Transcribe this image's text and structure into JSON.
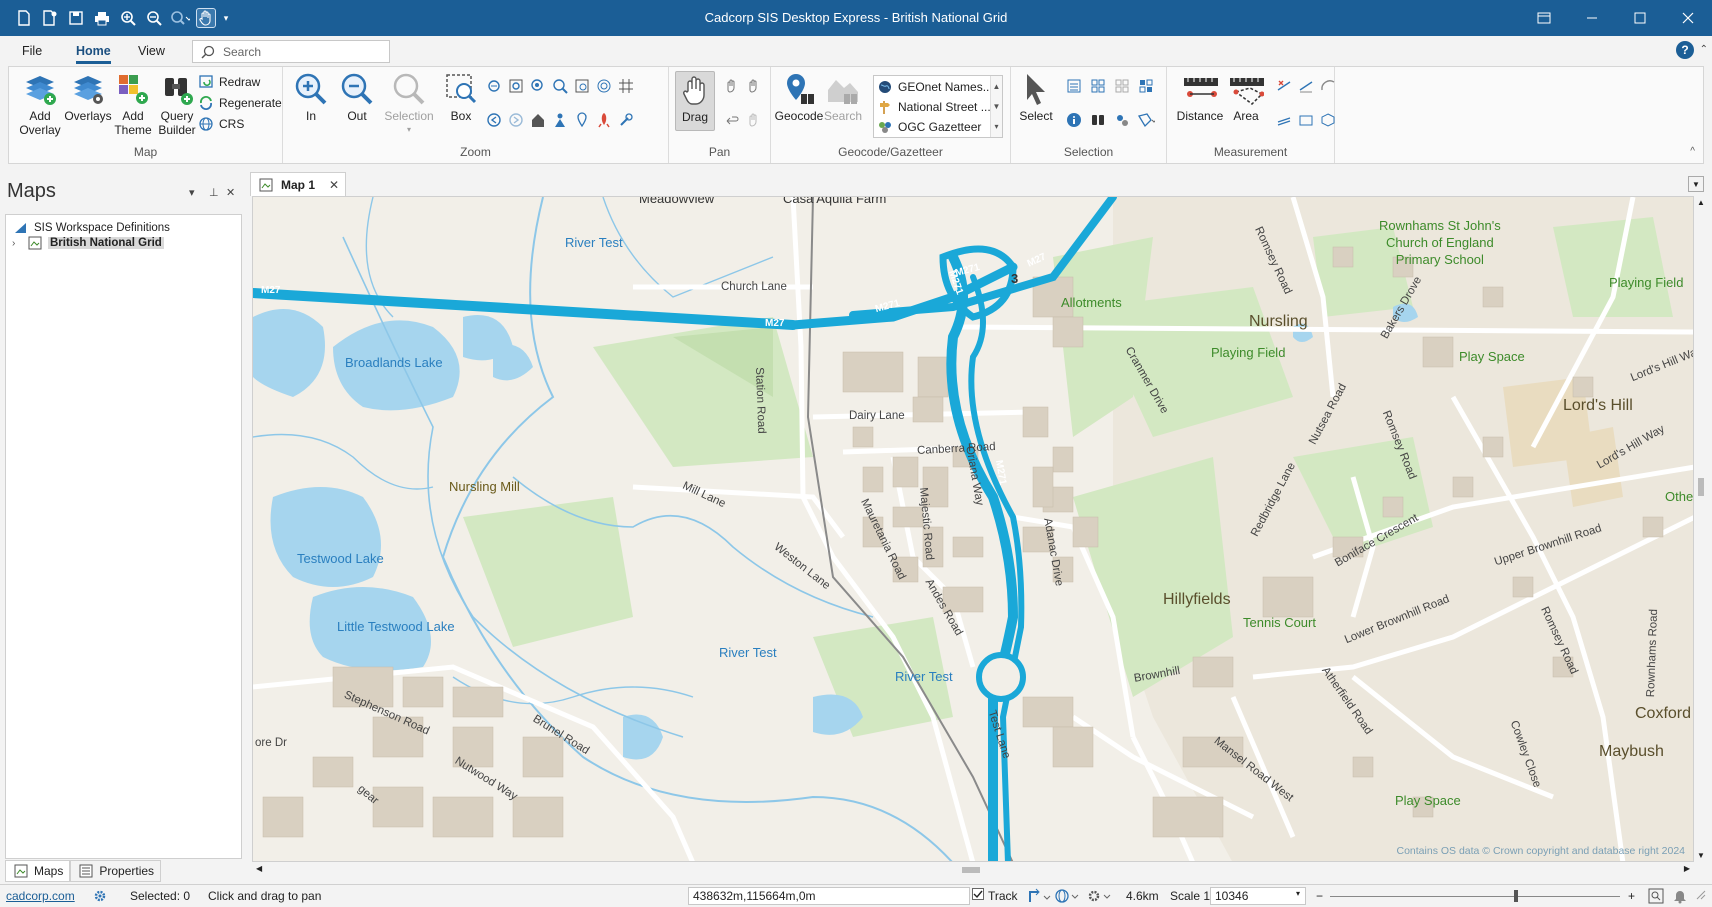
{
  "window": {
    "title": "Cadcorp SIS Desktop Express - British National Grid",
    "controls": [
      "restore-icon",
      "minimize-icon",
      "maximize-icon",
      "close-icon"
    ]
  },
  "ribbon_tabs": {
    "file": "File",
    "home": "Home",
    "view": "View",
    "search_placeholder": "Search"
  },
  "ribbon": {
    "map": {
      "label": "Map",
      "add_overlay": "Add\nOverlay",
      "overlays": "Overlays",
      "add_theme": "Add\nTheme",
      "query_builder": "Query\nBuilder",
      "redraw": "Redraw",
      "regenerate": "Regenerate",
      "crs": "CRS"
    },
    "zoom": {
      "label": "Zoom",
      "in": "In",
      "out": "Out",
      "selection": "Selection",
      "box": "Box"
    },
    "pan": {
      "label": "Pan",
      "drag": "Drag"
    },
    "geocode": {
      "label": "Geocode/Gazetteer",
      "geocode": "Geocode",
      "search": "Search",
      "gazetteers": [
        "GEOnet Names...",
        "National Street ...",
        "OGC Gazetteer"
      ]
    },
    "selection": {
      "label": "Selection",
      "select": "Select"
    },
    "measurement": {
      "label": "Measurement",
      "distance": "Distance",
      "area": "Area"
    }
  },
  "left_panel": {
    "title": "Maps",
    "tree_root": "SIS Workspace Definitions",
    "tree_child": "British National Grid",
    "tabs": [
      "Maps",
      "Properties"
    ]
  },
  "document_tab": {
    "label": "Map 1"
  },
  "map": {
    "labels": {
      "meadowview": "Meadowview",
      "casa_aquila": "Casa Aquila Farm",
      "river_test_1": "River Test",
      "church_lane": "Church Lane",
      "m27_left": "M27",
      "m27_mid": "M27",
      "m271_a": "M271",
      "m271_b": "M271",
      "m271_c": "M271",
      "m271_d": "M271",
      "m27_right": "M27",
      "junction_3": "3",
      "allotments": "Allotments",
      "rownhams": "Rownhams St John's\nChurch of England\nPrimary School",
      "playing_field_1": "Playing Field",
      "nursling": "Nursling",
      "playing_field_2": "Playing Field",
      "play_space_1": "Play Space",
      "broadlands_lake": "Broadlands Lake",
      "station_road": "Station Road",
      "dairy_lane": "Dairy Lane",
      "lords_hill": "Lord's Hill",
      "canberra_road": "Canberra Road",
      "nursling_mill": "Nursling Mill",
      "mill_lane": "Mill Lane",
      "testwood_lake": "Testwood Lake",
      "little_testwood_lake": "Little Testwood Lake",
      "weston_lane": "Weston Lane",
      "mauretania_road": "Mauretania Road",
      "majestic_road": "Majestic Road",
      "oriana_way": "Oriana Way",
      "adanac_drive": "Adanac Drive",
      "hillyfields": "Hillyfields",
      "tennis_court": "Tennis Court",
      "boniface_crescent": "Boniface Crescent",
      "upper_brownhill_road": "Upper Brownhill Road",
      "lower_brownhill_road": "Lower Brownhill Road",
      "river_test_2": "River Test",
      "river_test_3": "River Test",
      "andes_road": "Andes Road",
      "brownhill": "Brownhill",
      "stephenson_road": "Stephenson Road",
      "brunel_road": "Brunel Road",
      "nutwood_way": "Nutwood Way",
      "test_lane": "Test Lane",
      "mansel_road_west": "Mansel Road West",
      "athefield_road": "Atherfield Road",
      "romsey_road_1": "Romsey Road",
      "romsey_road_2": "Romsey Road",
      "romsey_road_3": "Romsey Road",
      "rownhams_road": "Rownhams Road",
      "redbridge_lane": "Redbridge Lane",
      "nutsea_road": "Nutsea Road",
      "cranmer_drive": "Cranmer Drive",
      "bakers_drove": "Bakers Drove",
      "lords_hill_way": "Lord's Hill Way",
      "lords_hill_way_2": "Lord's Hill Way",
      "coxford": "Coxford",
      "maybush": "Maybush",
      "cowley_close": "Cowley Close",
      "play_space_2": "Play Space",
      "other": "Othe",
      "ore_dr": "ore Dr",
      "gear": "gear"
    },
    "copyright": "Contains OS data © Crown copyright and database right 2024"
  },
  "status_bar": {
    "link": "cadcorp.com",
    "selected": "Selected: 0",
    "hint": "Click and drag to pan",
    "coords": "438632m,115664m,0m",
    "track": "Track",
    "distance": "4.6km",
    "scale_label": "Scale 1:",
    "scale_value": "10346",
    "zoom_percent": 0.64
  },
  "colors": {
    "titlebar": "#1b5e96",
    "motorway": "#1aa8d8",
    "water": "#a6d5ee",
    "green": "#d3e8c2",
    "building": "#d9d0c1",
    "urban": "#ece7dc"
  }
}
